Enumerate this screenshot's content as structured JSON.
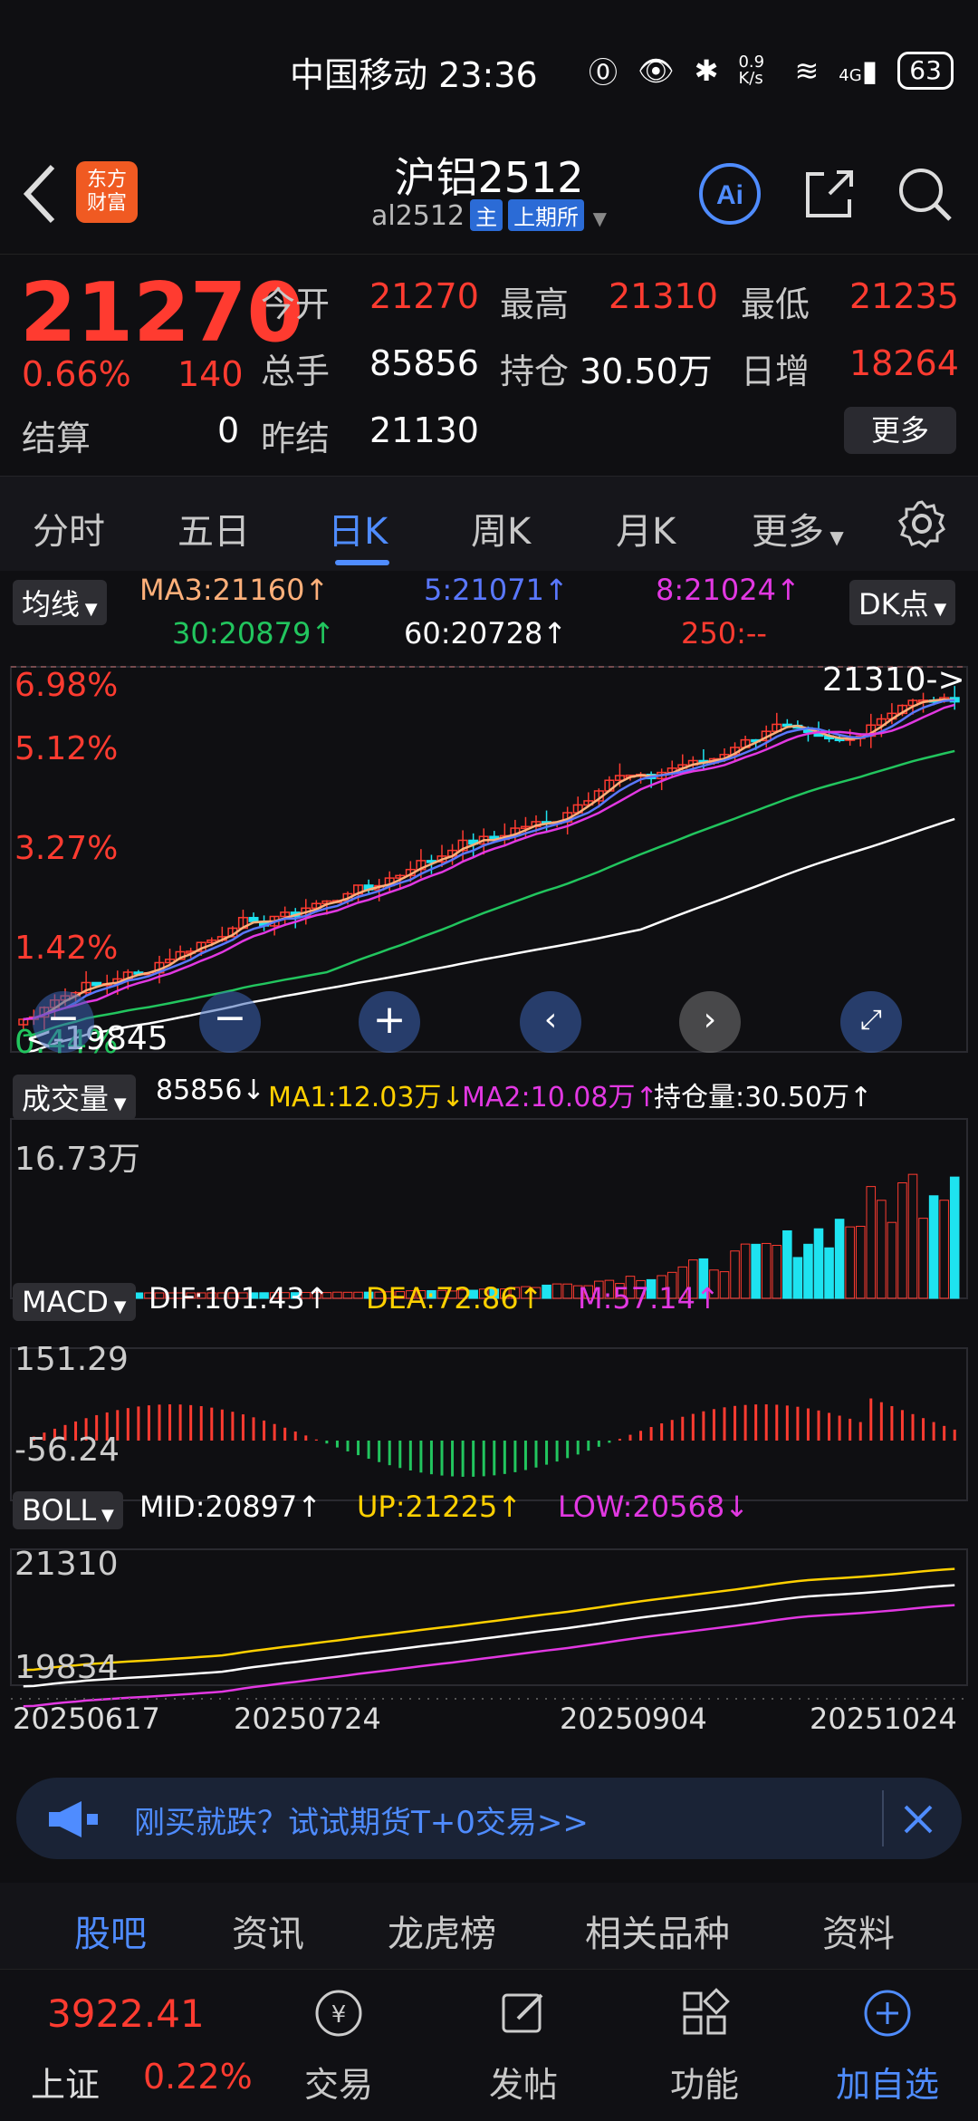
{
  "status": {
    "carrier": "中国移动",
    "time": "23:36",
    "speed": "0.9 K/s",
    "network": "4G",
    "battery": "63"
  },
  "header": {
    "logo_line1": "东方",
    "logo_line2": "财富",
    "title": "沪铝2512",
    "code": "al2512",
    "tag_main": "主",
    "tag_exchange": "上期所"
  },
  "quote": {
    "price": "21270",
    "change_pct": "0.66%",
    "change": "140",
    "open_label": "今开",
    "open": "21270",
    "high_label": "最高",
    "high": "21310",
    "low_label": "最低",
    "low": "21235",
    "volume_label": "总手",
    "volume": "85856",
    "oi_label": "持仓",
    "oi": "30.50万",
    "daychg_label": "日增",
    "daychg": "18264",
    "settle_label": "结算",
    "settle": "0",
    "prev_label": "昨结",
    "prev": "21130",
    "more": "更多"
  },
  "tabs": [
    "分时",
    "五日",
    "日K",
    "周K",
    "月K",
    "更多"
  ],
  "chart": {
    "ma_btn": "均线",
    "dk_btn": "DK点",
    "ma3": "MA3:21160↑",
    "ma5": "5:21071↑",
    "ma8": "8:21024↑",
    "ma30": "30:20879↑",
    "ma60": "60:20728↑",
    "ma250": "250:--",
    "pct_top": "6.98%",
    "pct_2": "5.12%",
    "pct_3": "3.27%",
    "pct_4": "1.42%",
    "pct_5": "0.44%",
    "high_marker": "21310->",
    "low_marker": "<-19845",
    "vol_btn": "成交量",
    "vol": "85856↓",
    "vol_ma1": "MA1:12.03万↓",
    "vol_ma2": "MA2:10.08万↑",
    "vol_oi": "持仓量:30.50万↑",
    "vol_max": "16.73万",
    "macd_btn": "MACD",
    "dif": "DIF:101.43↑",
    "dea": "DEA:72.86↑",
    "m": "M:57.14↑",
    "macd_max": "151.29",
    "macd_min": "-56.24",
    "boll_btn": "BOLL",
    "mid": "MID:20897↑",
    "up": "UP:21225↑",
    "low": "LOW:20568↓",
    "boll_max": "21310",
    "boll_min": "19834",
    "dates": [
      "20250617",
      "20250724",
      "20250904",
      "20251024"
    ]
  },
  "promo": {
    "text": "刚买就跌？试试期货T+0交易>>"
  },
  "bottom_tabs": [
    "股吧",
    "资讯",
    "龙虎榜",
    "相关品种",
    "资料"
  ],
  "nav": {
    "index_value": "3922.41",
    "index_name": "上证",
    "index_change": "0.22%",
    "items": [
      "交易",
      "发帖",
      "功能",
      "加自选"
    ]
  },
  "colors": {
    "up": "#ff3b30",
    "down": "#1ee3f0",
    "accent": "#4f8cff"
  }
}
